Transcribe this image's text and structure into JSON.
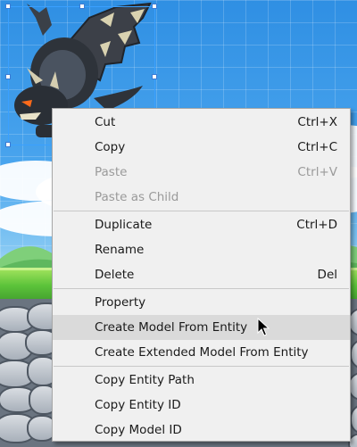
{
  "context_menu": {
    "groups": [
      [
        {
          "label": "Cut",
          "shortcut": "Ctrl+X",
          "enabled": true
        },
        {
          "label": "Copy",
          "shortcut": "Ctrl+C",
          "enabled": true
        },
        {
          "label": "Paste",
          "shortcut": "Ctrl+V",
          "enabled": false
        },
        {
          "label": "Paste as Child",
          "shortcut": "",
          "enabled": false
        }
      ],
      [
        {
          "label": "Duplicate",
          "shortcut": "Ctrl+D",
          "enabled": true
        },
        {
          "label": "Rename",
          "shortcut": "",
          "enabled": true
        },
        {
          "label": "Delete",
          "shortcut": "Del",
          "enabled": true
        }
      ],
      [
        {
          "label": "Property",
          "shortcut": "",
          "enabled": true
        },
        {
          "label": "Create Model From Entity",
          "shortcut": "",
          "enabled": true,
          "hovered": true
        },
        {
          "label": "Create Extended Model From Entity",
          "shortcut": "",
          "enabled": true
        }
      ],
      [
        {
          "label": "Copy Entity Path",
          "shortcut": "",
          "enabled": true
        },
        {
          "label": "Copy Entity ID",
          "shortcut": "",
          "enabled": true
        },
        {
          "label": "Copy Model ID",
          "shortcut": "",
          "enabled": true
        }
      ]
    ]
  },
  "scene": {
    "selected_entity": "dragon-sprite",
    "colors": {
      "selection": "#3aa0ff",
      "sky": "#4aa5ee",
      "grass": "#5cc33a",
      "menu_bg": "#f0f0f0",
      "hover_bg": "#dadada"
    }
  }
}
